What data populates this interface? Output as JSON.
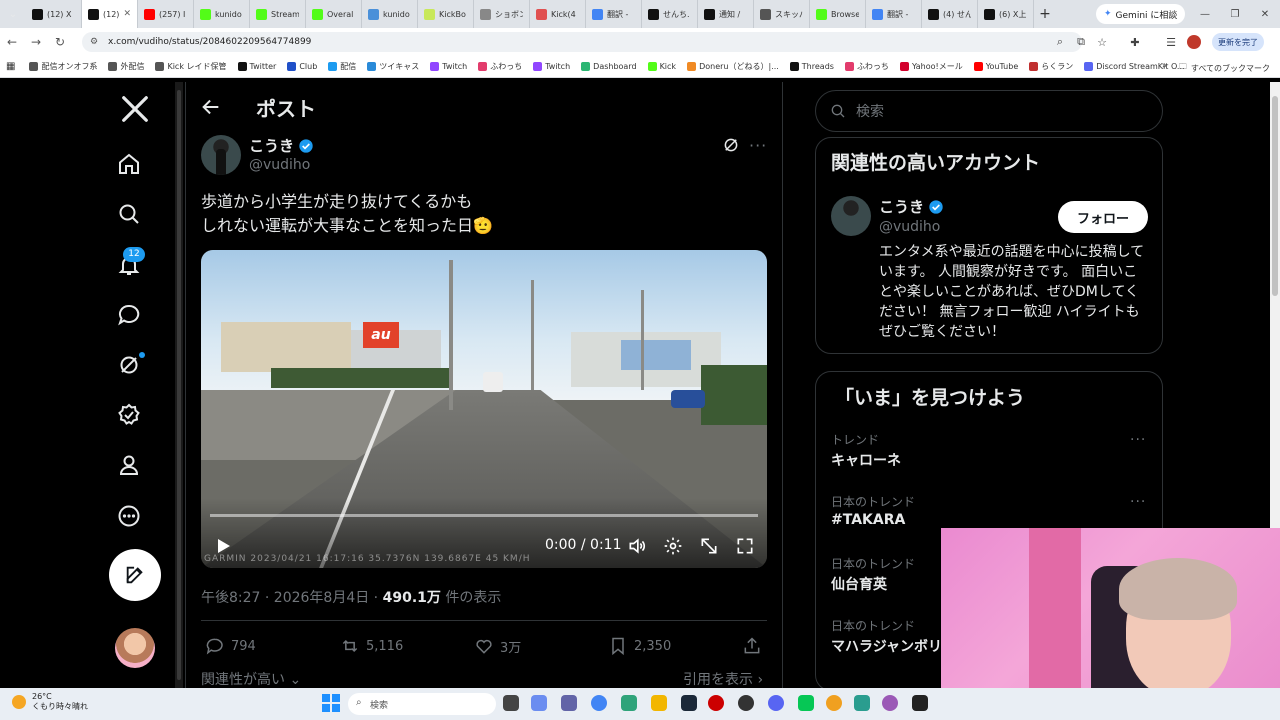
{
  "browser": {
    "tabs": [
      {
        "label": "(12) X",
        "icon": "x-logo-icon",
        "color": "#111111"
      },
      {
        "label": "(12) X",
        "icon": "x-logo-icon",
        "color": "#111111",
        "active": true
      },
      {
        "label": "(257) I",
        "icon": "youtube-icon",
        "color": "#ff0000"
      },
      {
        "label": "kunido",
        "icon": "kick-icon",
        "color": "#53fc18"
      },
      {
        "label": "Stream",
        "icon": "kick-icon",
        "color": "#53fc18"
      },
      {
        "label": "Overal",
        "icon": "kick-icon",
        "color": "#53fc18"
      },
      {
        "label": "kunido",
        "icon": "globe-icon",
        "color": "#4a90d9"
      },
      {
        "label": "KickBo",
        "icon": "kickbot-icon",
        "color": "#c8e85a"
      },
      {
        "label": "ショボン",
        "icon": "shobon-icon",
        "color": "#888888"
      },
      {
        "label": "Kick(4",
        "icon": "kick-alt-icon",
        "color": "#e05050"
      },
      {
        "label": "翻訳 -",
        "icon": "google-icon",
        "color": "#4285f4"
      },
      {
        "label": "せんち.",
        "icon": "x-logo-icon",
        "color": "#111111"
      },
      {
        "label": "通知 /",
        "icon": "x-logo-icon",
        "color": "#111111"
      },
      {
        "label": "スキッパ",
        "icon": "skip-icon",
        "color": "#555555"
      },
      {
        "label": "Browse",
        "icon": "kick-icon",
        "color": "#53fc18"
      },
      {
        "label": "翻訳 -",
        "icon": "google-icon",
        "color": "#4285f4"
      },
      {
        "label": "(4) せん",
        "icon": "x-logo-icon",
        "color": "#111111"
      },
      {
        "label": "(6) X上",
        "icon": "x-logo-icon",
        "color": "#111111"
      }
    ],
    "gemini_label": "Gemini に相談",
    "url": "x.com/vudiho/status/2084602209564774899",
    "update_label": "更新を完了",
    "bookmarks": [
      {
        "label": "配信オンオフ系",
        "color": "#555555"
      },
      {
        "label": "外配信",
        "color": "#555555"
      },
      {
        "label": "Kick レイド保管",
        "color": "#555555"
      },
      {
        "label": "Twitter",
        "color": "#111111"
      },
      {
        "label": "Club",
        "color": "#2050c8"
      },
      {
        "label": "配信",
        "color": "#1d9bf0"
      },
      {
        "label": "ツイキャス",
        "color": "#2a8ad8"
      },
      {
        "label": "Twitch",
        "color": "#9146ff"
      },
      {
        "label": "ふわっち",
        "color": "#e23c6c"
      },
      {
        "label": "Twitch",
        "color": "#9146ff"
      },
      {
        "label": "Dashboard",
        "color": "#2bb673"
      },
      {
        "label": "Kick",
        "color": "#53fc18"
      },
      {
        "label": "Doneru（どねる）|...",
        "color": "#f08a24"
      },
      {
        "label": "Threads",
        "color": "#111111"
      },
      {
        "label": "ふわっち",
        "color": "#e23c6c"
      },
      {
        "label": "Yahoo!メール",
        "color": "#d3002d"
      },
      {
        "label": "YouTube",
        "color": "#ff0000"
      },
      {
        "label": "らくラン",
        "color": "#c03030"
      },
      {
        "label": "Discord StreamKit O...",
        "color": "#5865f2"
      }
    ],
    "all_bookmarks": "すべてのブックマーク"
  },
  "nav": {
    "notif_count": "12"
  },
  "post": {
    "header_title": "ポスト",
    "author_name": "こうき",
    "author_handle": "@vudiho",
    "text_line1": "歩道から小学生が走り抜けてくるかも",
    "text_line2": "しれない運転が大事なことを知った日🫡",
    "video": {
      "time": "0:00 / 0:11",
      "overlay_text": "GARMIN  2023/04/21 16:17:16  35.7376N 139.6867E  45 KM/H",
      "sign_text": "au"
    },
    "meta_time": "午後8:27 · 2026年8月4日 · ",
    "meta_views": "490.1万",
    "meta_views_suffix": " 件の表示",
    "replies": "794",
    "reposts": "5,116",
    "likes": "3万",
    "bookmarks": "2,350",
    "relevance_label": "関連性が高い",
    "quote_label": "引用を表示"
  },
  "sidebar": {
    "search_placeholder": "検索",
    "related_title": "関連性の高いアカウント",
    "account_name": "こうき",
    "account_handle": "@vudiho",
    "follow_label": "フォロー",
    "bio": "エンタメ系や最近の話題を中心に投稿しています。 人間観察が好きです。 面白いことや楽しいことがあれば、ぜひDMしてください！ 無言フォロー歓迎 ハイライトもぜひご覧ください！",
    "trends_title": "「いま」を見つけよう",
    "trends": [
      {
        "context": "トレンド",
        "name": "キャローネ"
      },
      {
        "context": "日本のトレンド",
        "name": "#TAKARA"
      },
      {
        "context": "日本のトレンド",
        "name": "仙台育英"
      },
      {
        "context": "日本のトレンド",
        "name": "マハラジャンボリ"
      }
    ]
  },
  "taskbar": {
    "temp": "26°C",
    "weather": "くもり時々晴れ",
    "search_label": "検索"
  },
  "colors": {
    "accent": "#1d9bf0",
    "background": "#000000",
    "muted": "#71767b",
    "border": "#2f3336"
  }
}
